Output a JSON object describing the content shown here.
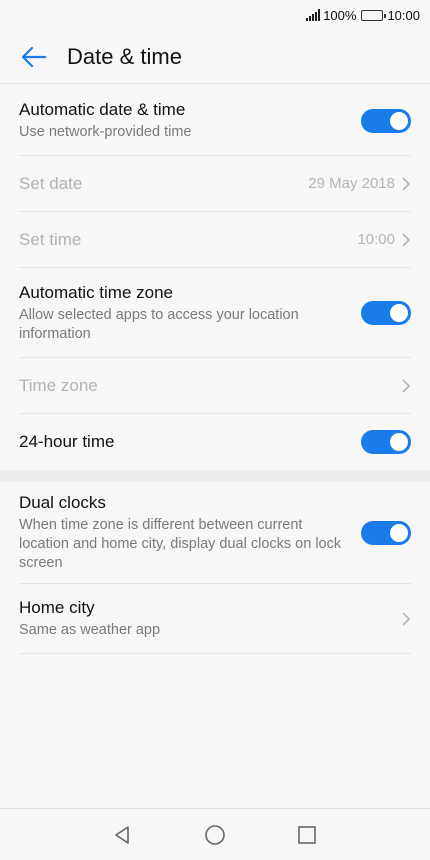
{
  "status": {
    "battery_text": "100%",
    "time": "10:00"
  },
  "header": {
    "title": "Date & time"
  },
  "rows": {
    "auto_datetime": {
      "title": "Automatic date & time",
      "sub": "Use network-provided time",
      "on": true
    },
    "set_date": {
      "title": "Set date",
      "value": "29 May 2018"
    },
    "set_time": {
      "title": "Set time",
      "value": "10:00"
    },
    "auto_timezone": {
      "title": "Automatic time zone",
      "sub": "Allow selected apps to access your location information",
      "on": true
    },
    "time_zone": {
      "title": "Time zone"
    },
    "hour24": {
      "title": "24-hour time",
      "on": true
    },
    "dual_clocks": {
      "title": "Dual clocks",
      "sub": "When time zone is different between current location and home city, display dual clocks on lock screen",
      "on": true
    },
    "home_city": {
      "title": "Home city",
      "sub": "Same as weather app"
    }
  },
  "colors": {
    "accent": "#1a7bea"
  },
  "icons": {
    "back": "back-arrow-icon",
    "chevron": "chevron-right-icon",
    "nav_back": "triangle-back-icon",
    "nav_home": "circle-home-icon",
    "nav_recent": "square-recents-icon"
  }
}
